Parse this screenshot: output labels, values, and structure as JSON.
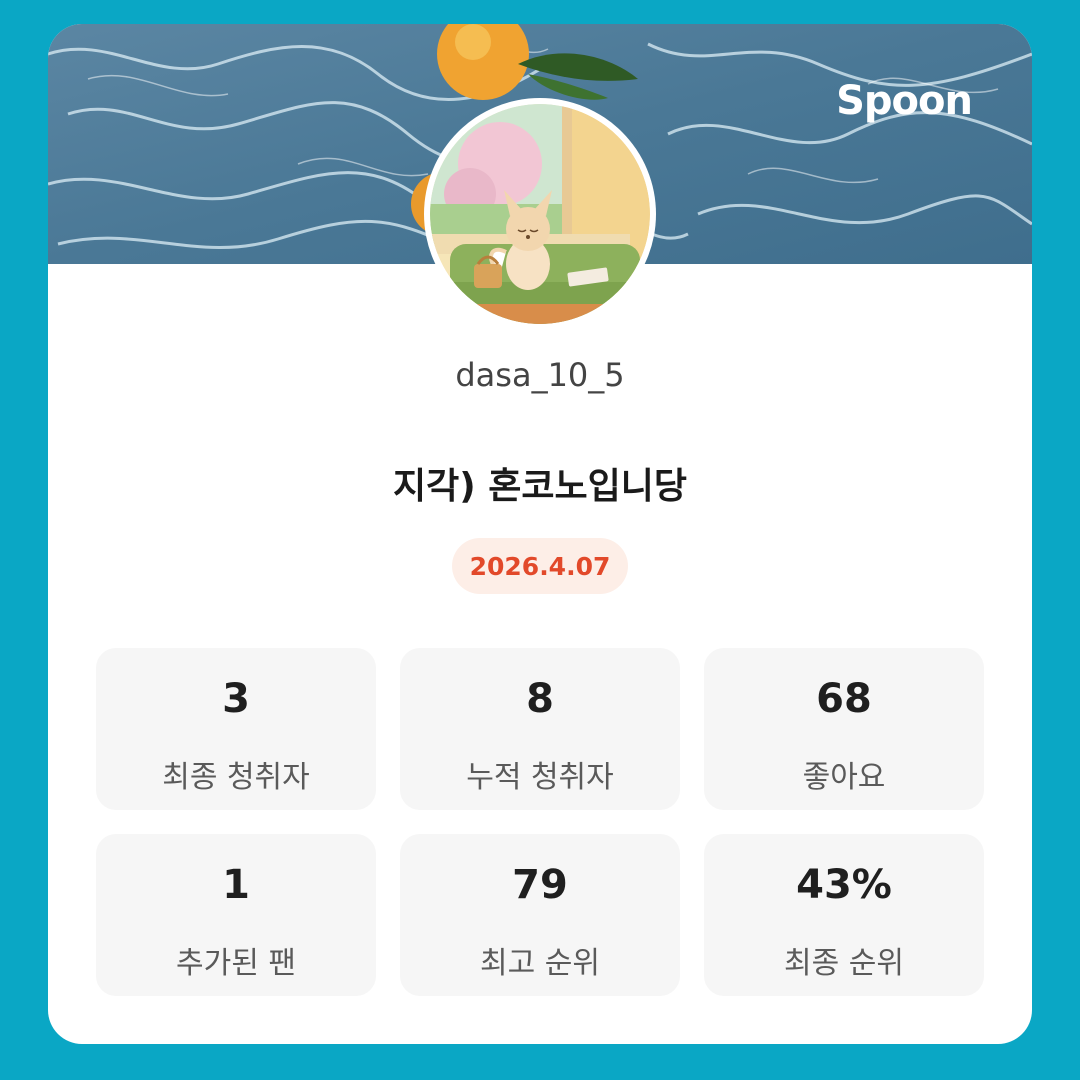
{
  "brand": {
    "logo_text": "Spoon",
    "background_color": "#0aa7c5"
  },
  "profile": {
    "username": "dasa_10_5",
    "avatar_icon": "fox-avatar-illustration"
  },
  "broadcast": {
    "title": "지각) 혼코노입니당",
    "date": "2026.4.07",
    "date_color": "#e2492a"
  },
  "stats": [
    {
      "value": "3",
      "label": "최종 청취자"
    },
    {
      "value": "8",
      "label": "누적 청취자"
    },
    {
      "value": "68",
      "label": "좋아요"
    },
    {
      "value": "1",
      "label": "추가된 팬"
    },
    {
      "value": "79",
      "label": "최고 순위"
    },
    {
      "value": "43%",
      "label": "최종 순위"
    }
  ]
}
